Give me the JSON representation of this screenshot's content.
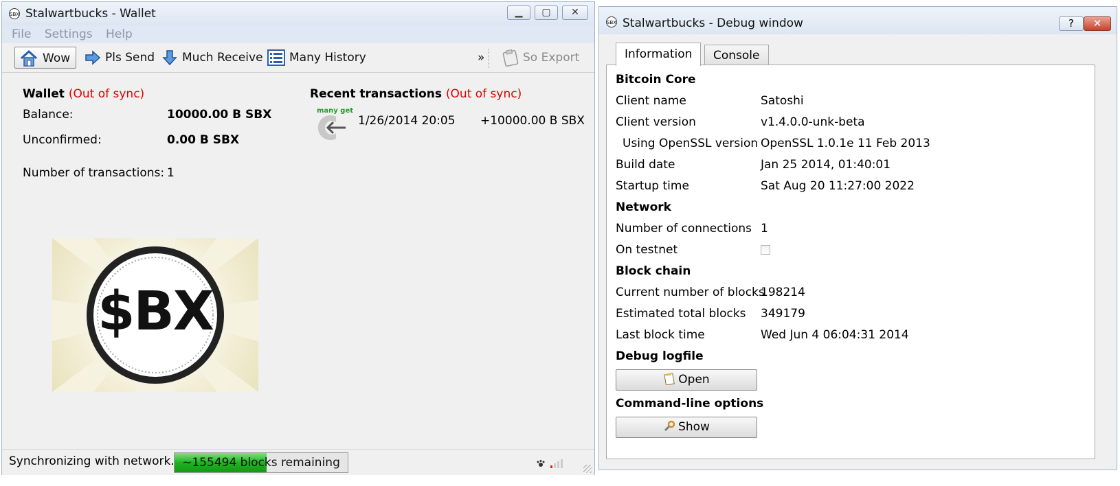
{
  "wallet": {
    "title": "Stalwartbucks - Wallet",
    "title_icon_text": "SBX",
    "window_buttons": {
      "minimize": "▁",
      "maximize": "▢",
      "close": "✕"
    },
    "menu": [
      "File",
      "Settings",
      "Help"
    ],
    "toolbar": {
      "overview": "Wow",
      "send": "Pls Send",
      "receive": "Much Receive",
      "history": "Many History",
      "more": "»",
      "export": "So Export"
    },
    "overview": {
      "wallet_label": "Wallet",
      "out_of_sync": "(Out of sync)",
      "balance_label": "Balance:",
      "balance_value": "10000.00 B SBX",
      "unconfirmed_label": "Unconfirmed:",
      "unconfirmed_value": "0.00 B SBX",
      "num_tx_label": "Number of transactions:",
      "num_tx_value": "1",
      "recent_label": "Recent transactions",
      "recent_out_of_sync": "(Out of sync)",
      "transactions": [
        {
          "icon_text": "many get",
          "date": "1/26/2014 20:05",
          "amount": "+10000.00 B SBX"
        }
      ],
      "logo_text": "$BX"
    },
    "status": {
      "text": "Synchronizing with network...",
      "progress_text": "~155494 blocks remaining",
      "progress_fraction": 0.53
    }
  },
  "debug": {
    "title": "Stalwartbucks - Debug window",
    "title_icon_text": "SBX",
    "help_button": "?",
    "close_button": "✕",
    "tabs": [
      "Information",
      "Console"
    ],
    "sections": {
      "core": "Bitcoin Core",
      "network": "Network",
      "blockchain": "Block chain",
      "logfile": "Debug logfile",
      "cmdline": "Command-line options"
    },
    "info": {
      "client_name_label": "Client name",
      "client_name": "Satoshi",
      "client_version_label": "Client version",
      "client_version": "v1.4.0.0-unk-beta",
      "openssl_label": "Using OpenSSL version",
      "openssl": "OpenSSL 1.0.1e 11 Feb 2013",
      "build_date_label": "Build date",
      "build_date": "Jan 25 2014, 01:40:01",
      "startup_label": "Startup time",
      "startup": "Sat Aug 20 11:27:00 2022",
      "connections_label": "Number of connections",
      "connections": "1",
      "testnet_label": "On testnet",
      "blocks_label": "Current number of blocks",
      "blocks": "198214",
      "total_blocks_label": "Estimated total blocks",
      "total_blocks": "349179",
      "last_block_label": "Last block time",
      "last_block": "Wed Jun 4 06:04:31 2014"
    },
    "buttons": {
      "open": "Open",
      "show": "Show"
    }
  }
}
